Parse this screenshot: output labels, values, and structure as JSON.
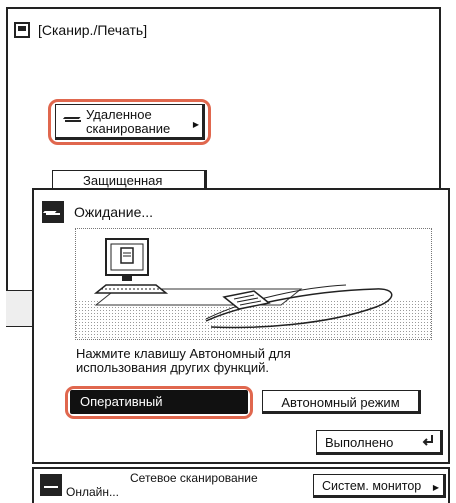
{
  "background": {
    "title": "[Сканир./Печать]",
    "remote_scan_button": {
      "line1": "Удаленное",
      "line2": "сканирование"
    },
    "secure_button": "Защищенная"
  },
  "dialog": {
    "title": "Ожидание...",
    "message_line1": "Нажмите клавишу Автономный для",
    "message_line2": "использования других функций.",
    "online_button": "Оперативный",
    "offline_button": "Автономный режим",
    "done_button": "Выполнено"
  },
  "statusbar": {
    "title": "Сетевое сканирование",
    "status": "Онлайн...",
    "system_monitor_button": "Систем. монитор"
  },
  "colors": {
    "highlight": "#e0674e",
    "dark": "#111111"
  }
}
